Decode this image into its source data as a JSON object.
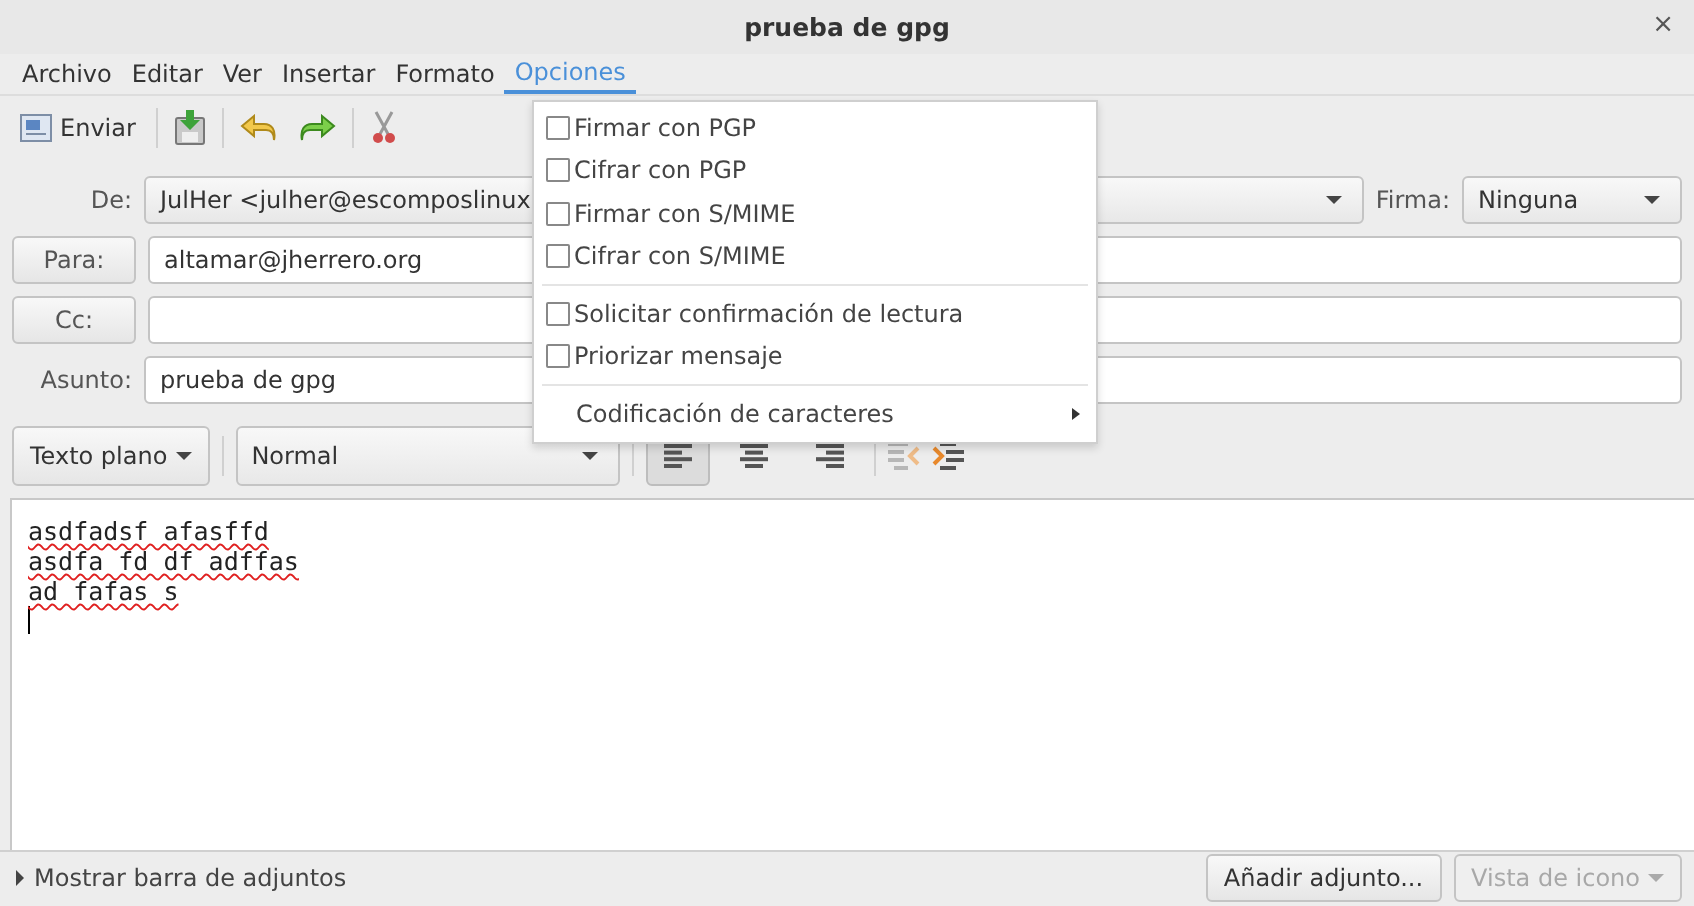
{
  "window": {
    "title": "prueba de gpg",
    "close": "×"
  },
  "menubar": [
    {
      "label": "Archivo",
      "selected": false
    },
    {
      "label": "Editar",
      "selected": false
    },
    {
      "label": "Ver",
      "selected": false
    },
    {
      "label": "Insertar",
      "selected": false
    },
    {
      "label": "Formato",
      "selected": false
    },
    {
      "label": "Opciones",
      "selected": true
    }
  ],
  "toolbar": {
    "send": "Enviar"
  },
  "header": {
    "from_label": "De:",
    "from_value": "JulHer <julher@escomposlinux",
    "signature_label": "Firma:",
    "signature_value": "Ninguna",
    "to_button": "Para:",
    "to_value": "altamar@jherrero.org",
    "cc_button": "Cc:",
    "subject_label": "Asunto:",
    "subject_value": "prueba de gpg"
  },
  "format_bar": {
    "mode": "Texto plano",
    "style": "Normal",
    "align_buttons": [
      {
        "kind": "left",
        "selected": true
      },
      {
        "kind": "center",
        "selected": false
      },
      {
        "kind": "right",
        "selected": false
      }
    ]
  },
  "body_lines": [
    "asdfadsf afasffd",
    "asdfa fd df adffas",
    "ad fafas s"
  ],
  "attachments": {
    "toggle": "Mostrar barra de adjuntos",
    "add": "Añadir adjunto...",
    "view": "Vista de icono"
  },
  "options_menu": [
    {
      "kind": "check",
      "label": "Firmar con PGP",
      "checked": false
    },
    {
      "kind": "check",
      "label": "Cifrar con PGP",
      "checked": false
    },
    {
      "kind": "check",
      "label": "Firmar con S/MIME",
      "checked": false
    },
    {
      "kind": "check",
      "label": "Cifrar con S/MIME",
      "checked": false
    },
    {
      "kind": "separator"
    },
    {
      "kind": "check",
      "label": "Solicitar confirmación de lectura",
      "checked": false
    },
    {
      "kind": "check",
      "label": "Priorizar mensaje",
      "checked": false
    },
    {
      "kind": "separator"
    },
    {
      "kind": "submenu",
      "label": "Codificación de caracteres"
    }
  ]
}
